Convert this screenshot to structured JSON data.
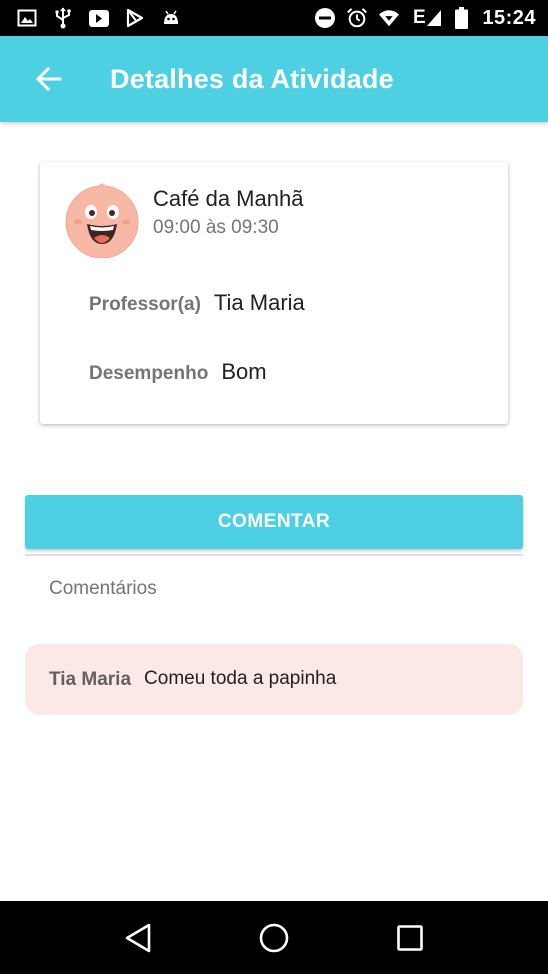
{
  "status_bar": {
    "time": "15:24",
    "left_icons": [
      "image-icon",
      "usb-icon",
      "app-store-icon",
      "play-store-icon",
      "android-icon"
    ],
    "right_icons": [
      "do-not-disturb-icon",
      "alarm-icon",
      "wifi-icon",
      "network-e-icon",
      "battery-icon"
    ],
    "network_label": "E"
  },
  "app_bar": {
    "title": "Detalhes da Atividade",
    "back_icon": "arrow-back-icon",
    "color": "#4dd0e1"
  },
  "activity": {
    "avatar_icon": "baby-face-icon",
    "name": "Café da Manhã",
    "time": "09:00 às 09:30",
    "teacher_label": "Professor(a)",
    "teacher": "Tia Maria",
    "performance_label": "Desempenho",
    "performance": "Bom"
  },
  "comment_button": {
    "label": "COMENTAR"
  },
  "comments": {
    "heading": "Comentários",
    "items": [
      {
        "author": "Tia Maria",
        "text": "Comeu toda a papinha",
        "color": "#fbe9e7"
      }
    ]
  },
  "nav_bar": {
    "icons": [
      "nav-back-icon",
      "nav-home-icon",
      "nav-recents-icon"
    ]
  }
}
